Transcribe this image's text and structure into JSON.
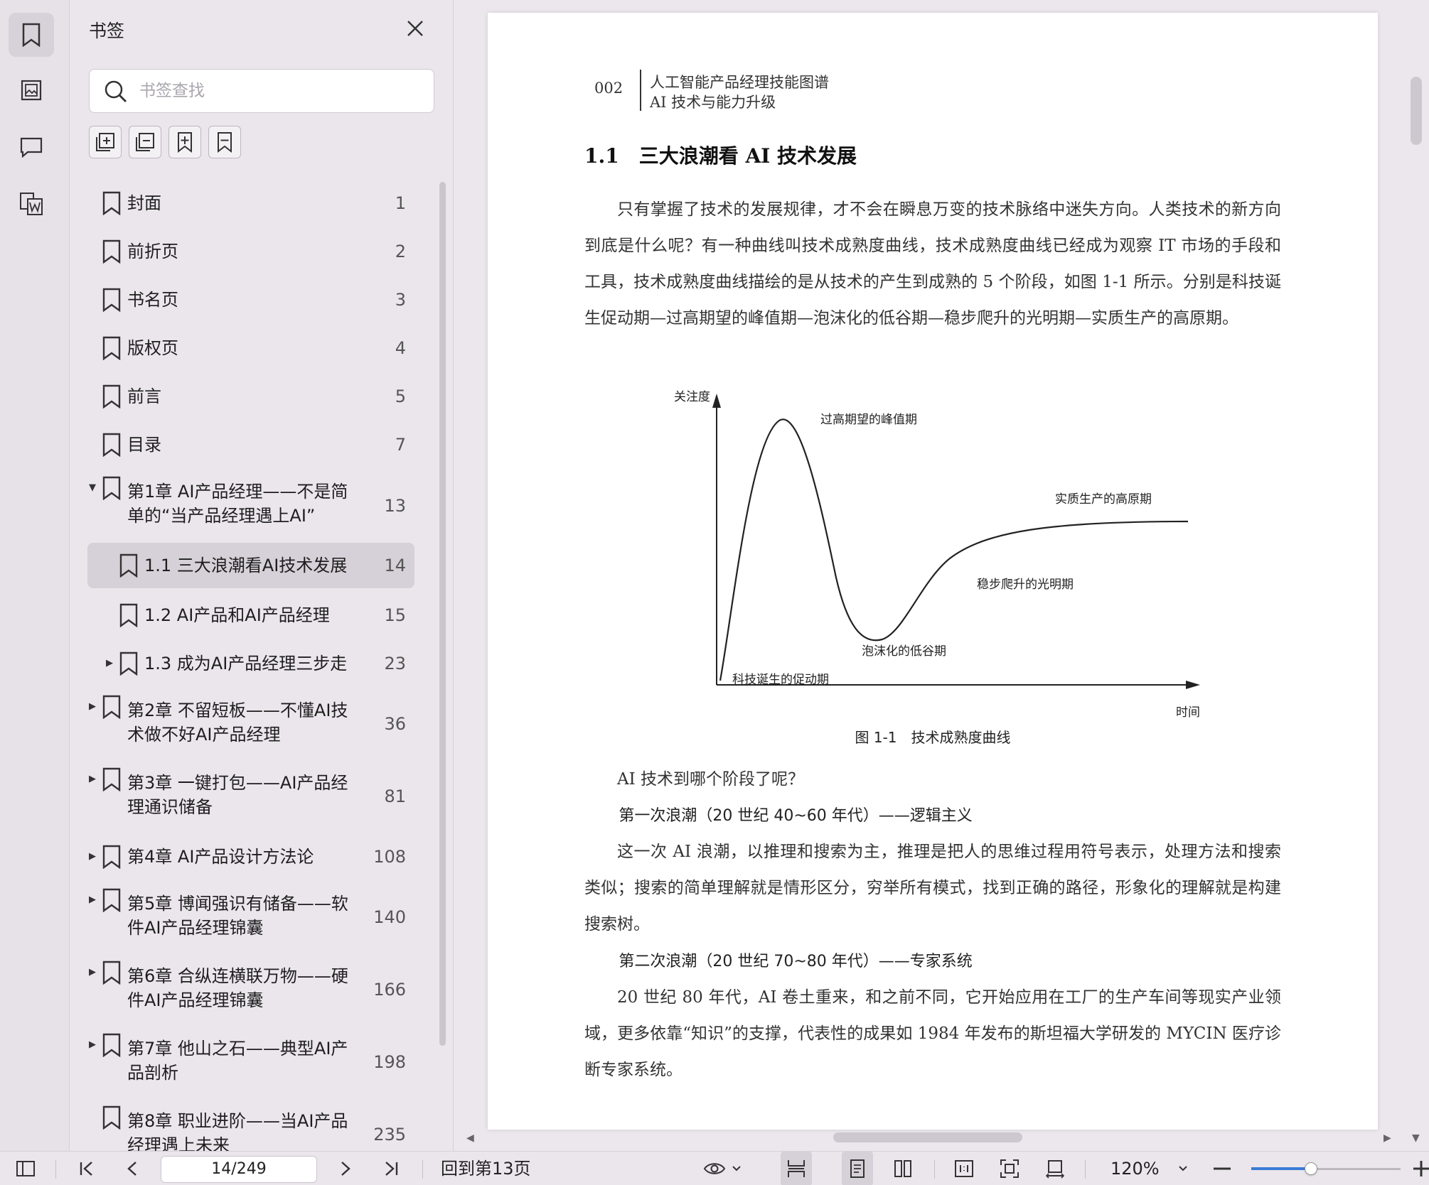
{
  "sidebar": {
    "title": "书签",
    "search_placeholder": "书签查找",
    "bookmarks": [
      {
        "label": "封面",
        "page": "1",
        "level": 0,
        "caret": "",
        "selected": false
      },
      {
        "label": "前折页",
        "page": "2",
        "level": 0,
        "caret": "",
        "selected": false
      },
      {
        "label": "书名页",
        "page": "3",
        "level": 0,
        "caret": "",
        "selected": false
      },
      {
        "label": "版权页",
        "page": "4",
        "level": 0,
        "caret": "",
        "selected": false
      },
      {
        "label": "前言",
        "page": "5",
        "level": 0,
        "caret": "",
        "selected": false
      },
      {
        "label": "目录",
        "page": "7",
        "level": 0,
        "caret": "",
        "selected": false
      },
      {
        "label": "第1章 AI产品经理——不是简单的“当产品经理遇上AI”",
        "page": "13",
        "level": 0,
        "caret": "expanded",
        "selected": false
      },
      {
        "label": "1.1 三大浪潮看AI技术发展",
        "page": "14",
        "level": 1,
        "caret": "",
        "selected": true
      },
      {
        "label": "1.2 AI产品和AI产品经理",
        "page": "15",
        "level": 1,
        "caret": "",
        "selected": false
      },
      {
        "label": "1.3 成为AI产品经理三步走",
        "page": "23",
        "level": 1,
        "caret": "collapsed",
        "selected": false
      },
      {
        "label": "第2章 不留短板——不懂AI技术做不好AI产品经理",
        "page": "36",
        "level": 0,
        "caret": "collapsed",
        "selected": false
      },
      {
        "label": "第3章 一键打包——AI产品经理通识储备",
        "page": "81",
        "level": 0,
        "caret": "collapsed",
        "selected": false
      },
      {
        "label": "第4章 AI产品设计方法论",
        "page": "108",
        "level": 0,
        "caret": "collapsed",
        "selected": false
      },
      {
        "label": "第5章 博闻强识有储备——软件AI产品经理锦囊",
        "page": "140",
        "level": 0,
        "caret": "collapsed",
        "selected": false
      },
      {
        "label": "第6章 合纵连横联万物——硬件AI产品经理锦囊",
        "page": "166",
        "level": 0,
        "caret": "collapsed",
        "selected": false
      },
      {
        "label": "第7章 他山之石——典型AI产品剖析",
        "page": "198",
        "level": 0,
        "caret": "collapsed",
        "selected": false
      },
      {
        "label": "第8章 职业进阶——当AI产品经理遇上未来",
        "page": "235",
        "level": 0,
        "caret": "",
        "selected": false
      }
    ]
  },
  "document": {
    "page_number": "002",
    "header_line1": "人工智能产品经理技能图谱",
    "header_line2": "AI 技术与能力升级",
    "section_title": "1.1　三大浪潮看 AI 技术发展",
    "para1": "只有掌握了技术的发展规律，才不会在瞬息万变的技术脉络中迷失方向。人类技术的新方向到底是什么呢？有一种曲线叫技术成熟度曲线，技术成熟度曲线已经成为观察 IT 市场的手段和工具，技术成熟度曲线描绘的是从技术的产生到成熟的 5 个阶段，如图 1-1 所示。分别是科技诞生促动期—过高期望的峰值期—泡沫化的低谷期—稳步爬升的光明期—实质生产的高原期。",
    "figure": {
      "y_axis": "关注度",
      "x_axis": "时间",
      "peak": "过高期望的峰值期",
      "plateau": "实质生产的高原期",
      "slope": "稳步爬升的光明期",
      "trough": "泡沫化的低谷期",
      "trigger": "科技诞生的促动期",
      "caption": "图 1-1　技术成熟度曲线"
    },
    "question": "AI 技术到哪个阶段了呢？",
    "wave1_title": "第一次浪潮（20 世纪 40~60 年代）——逻辑主义",
    "wave1_text": "这一次 AI 浪潮，以推理和搜索为主，推理是把人的思维过程用符号表示，处理方法和搜索类似；搜索的简单理解就是情形区分，穷举所有模式，找到正确的路径，形象化的理解就是构建搜索树。",
    "wave2_title": "第二次浪潮（20 世纪 70~80 年代）——专家系统",
    "wave2_text": "20 世纪 80 年代，AI 卷土重来，和之前不同，它开始应用在工厂的生产车间等现实产业领域，更多依靠“知识”的支撑，代表性的成果如 1984 年发布的斯坦福大学研发的 MYCIN 医疗诊断专家系统。"
  },
  "bottombar": {
    "page_indicator": "14/249",
    "back_to": "回到第13页",
    "zoom": "120%",
    "zoom_fraction": 0.4
  }
}
